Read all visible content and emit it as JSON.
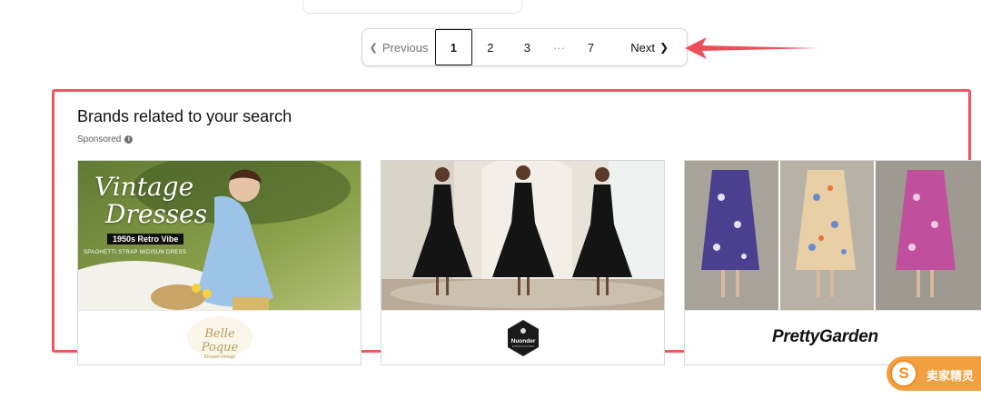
{
  "top_card": {
    "chip_a": "",
    "chip_b": ""
  },
  "pagination": {
    "previous_label": "Previous",
    "current_page": "1",
    "pages": [
      "2",
      "3"
    ],
    "ellipsis": "···",
    "last_page": "7",
    "next_label": "Next"
  },
  "brands": {
    "title": "Brands related to your search",
    "sponsored_label": "Sponsored",
    "cards": [
      {
        "image_title_line1": "Vintage",
        "image_title_line2": "Dresses",
        "image_tag": "1950s Retro Vibe",
        "image_subtitle": "SPAGHETTI STRAP MIDISUN DRESS",
        "brand_logo_text": "Belle Poque",
        "brand_logo_subtext": "Elegant vintage"
      },
      {
        "brand_logo_text": "Nuonder",
        "brand_logo_subtext": "FASHION CLOTHING"
      },
      {
        "brand_logo_text": "PrettyGarden"
      }
    ]
  },
  "badge": {
    "icon_letter": "S",
    "label": "卖家精灵"
  },
  "colors": {
    "highlight_red": "#f0575f",
    "arrow_red": "#ef4f5b",
    "badge_orange": "#f0a040"
  }
}
